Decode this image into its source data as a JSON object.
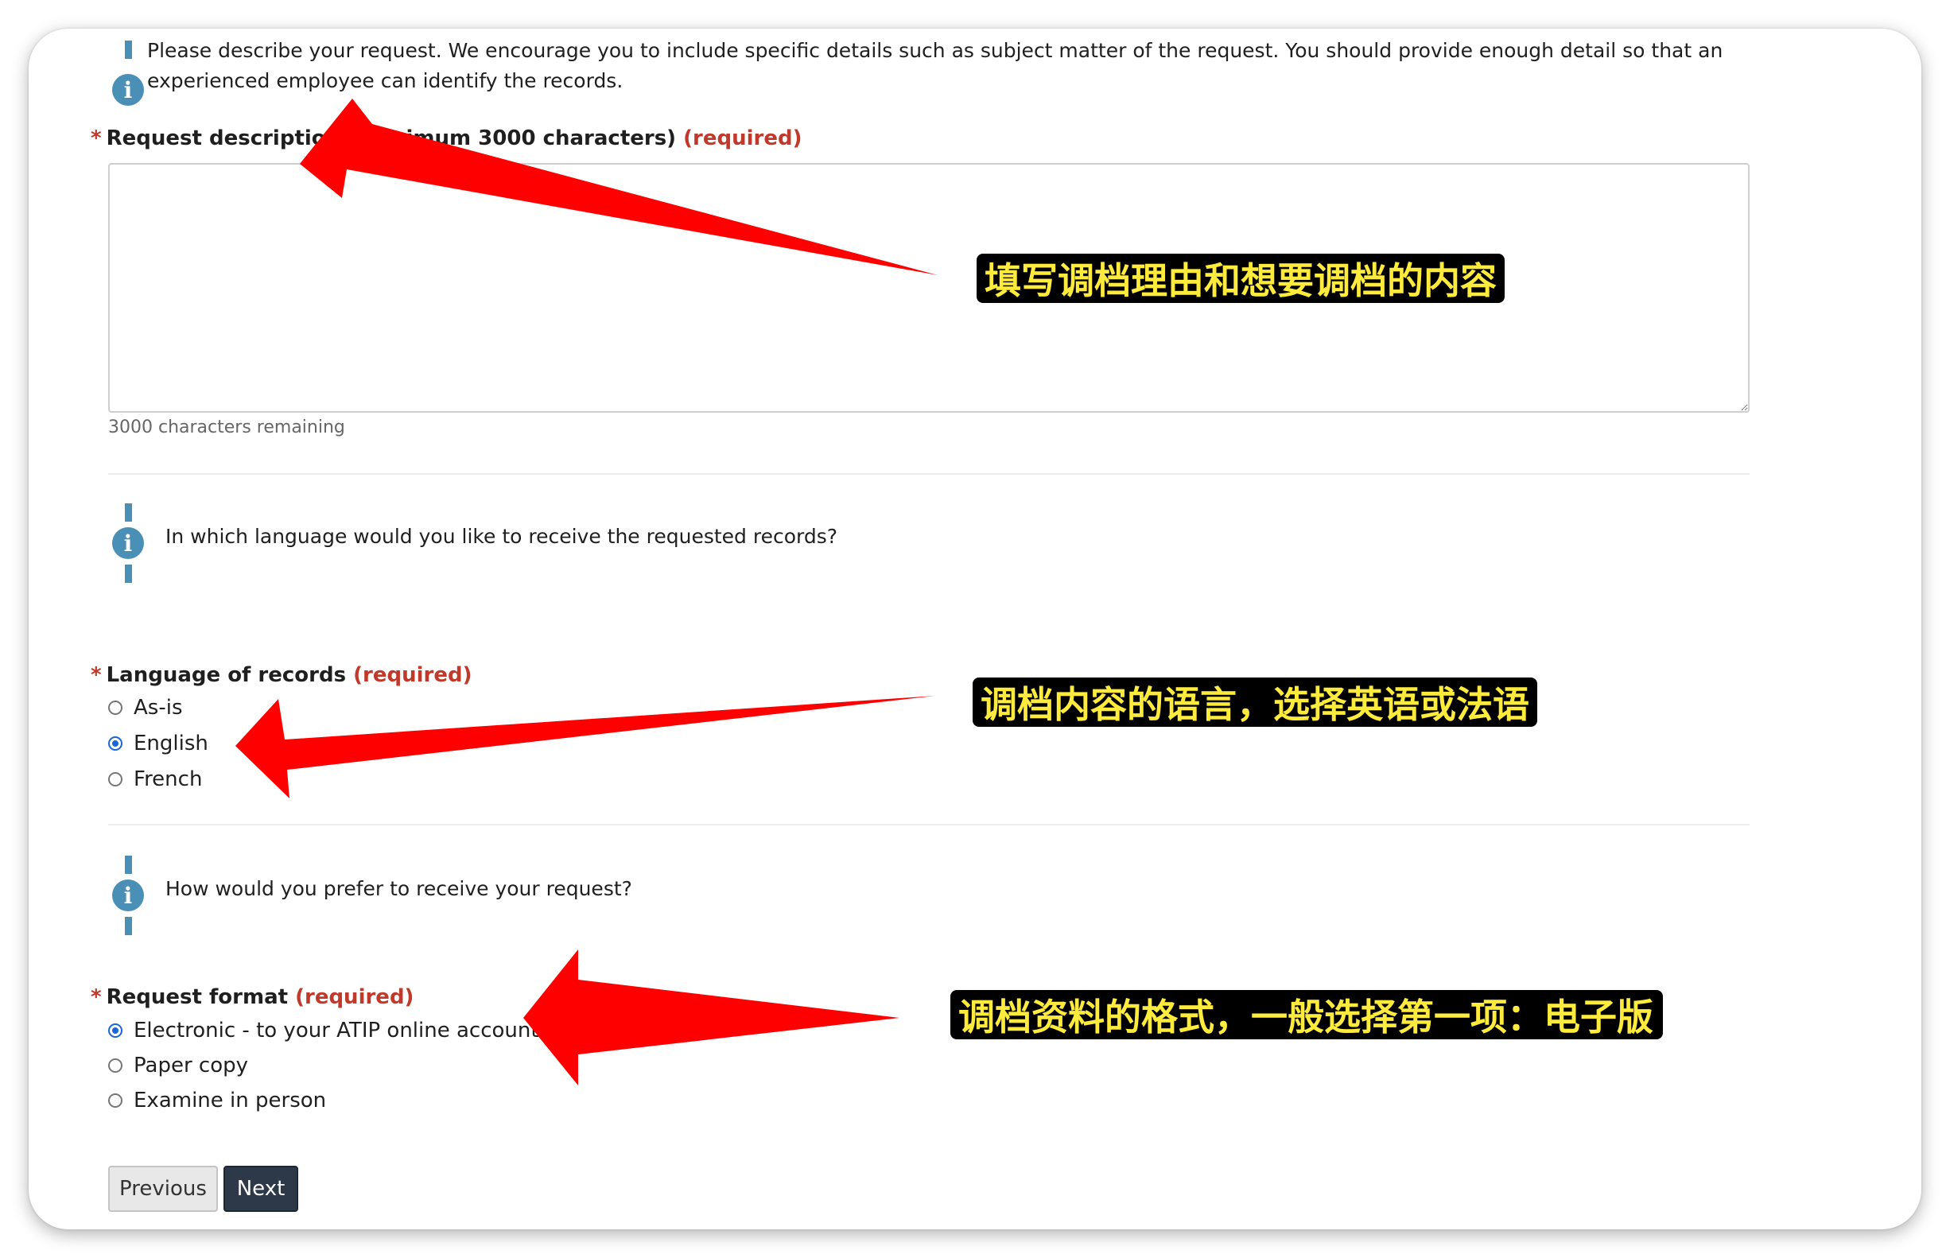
{
  "intro": {
    "text_line1": "Please describe your request. We encourage you to include specific details such as subject matter of the request. You should provide enough detail so that an",
    "text_line2": "experienced employee can identify the records."
  },
  "description": {
    "star": "*",
    "label": "Request description (maximum 3000 characters)",
    "required": "(required)",
    "value": "",
    "remaining": "3000 characters remaining"
  },
  "language_info": {
    "text": "In which language would you like to receive the requested records?"
  },
  "language": {
    "star": "*",
    "label": "Language of records",
    "required": "(required)",
    "options": [
      {
        "label": "As-is",
        "checked": false
      },
      {
        "label": "English",
        "checked": true
      },
      {
        "label": "French",
        "checked": false
      }
    ]
  },
  "format_info": {
    "text": "How would you prefer to receive your request?"
  },
  "format": {
    "star": "*",
    "label": "Request format",
    "required": "(required)",
    "options": [
      {
        "label": "Electronic - to your ATIP online account",
        "checked": true
      },
      {
        "label": "Paper copy",
        "checked": false
      },
      {
        "label": "Examine in person",
        "checked": false
      }
    ]
  },
  "buttons": {
    "previous": "Previous",
    "next": "Next"
  },
  "annotations": {
    "description_note": "填写调档理由和想要调档的内容",
    "language_note": "调档内容的语言，选择英语或法语",
    "format_note": "调档资料的格式，一般选择第一项：电子版"
  },
  "colors": {
    "required_red": "#c0392b",
    "info_blue": "#4a8fb5",
    "radio_blue": "#1a66d9",
    "next_button": "#2d3848",
    "arrow_red": "#ff0000",
    "annotation_text": "#ffeb3b"
  },
  "icons": {
    "info": "info-circle-icon",
    "arrow": "red-arrow-icon"
  }
}
